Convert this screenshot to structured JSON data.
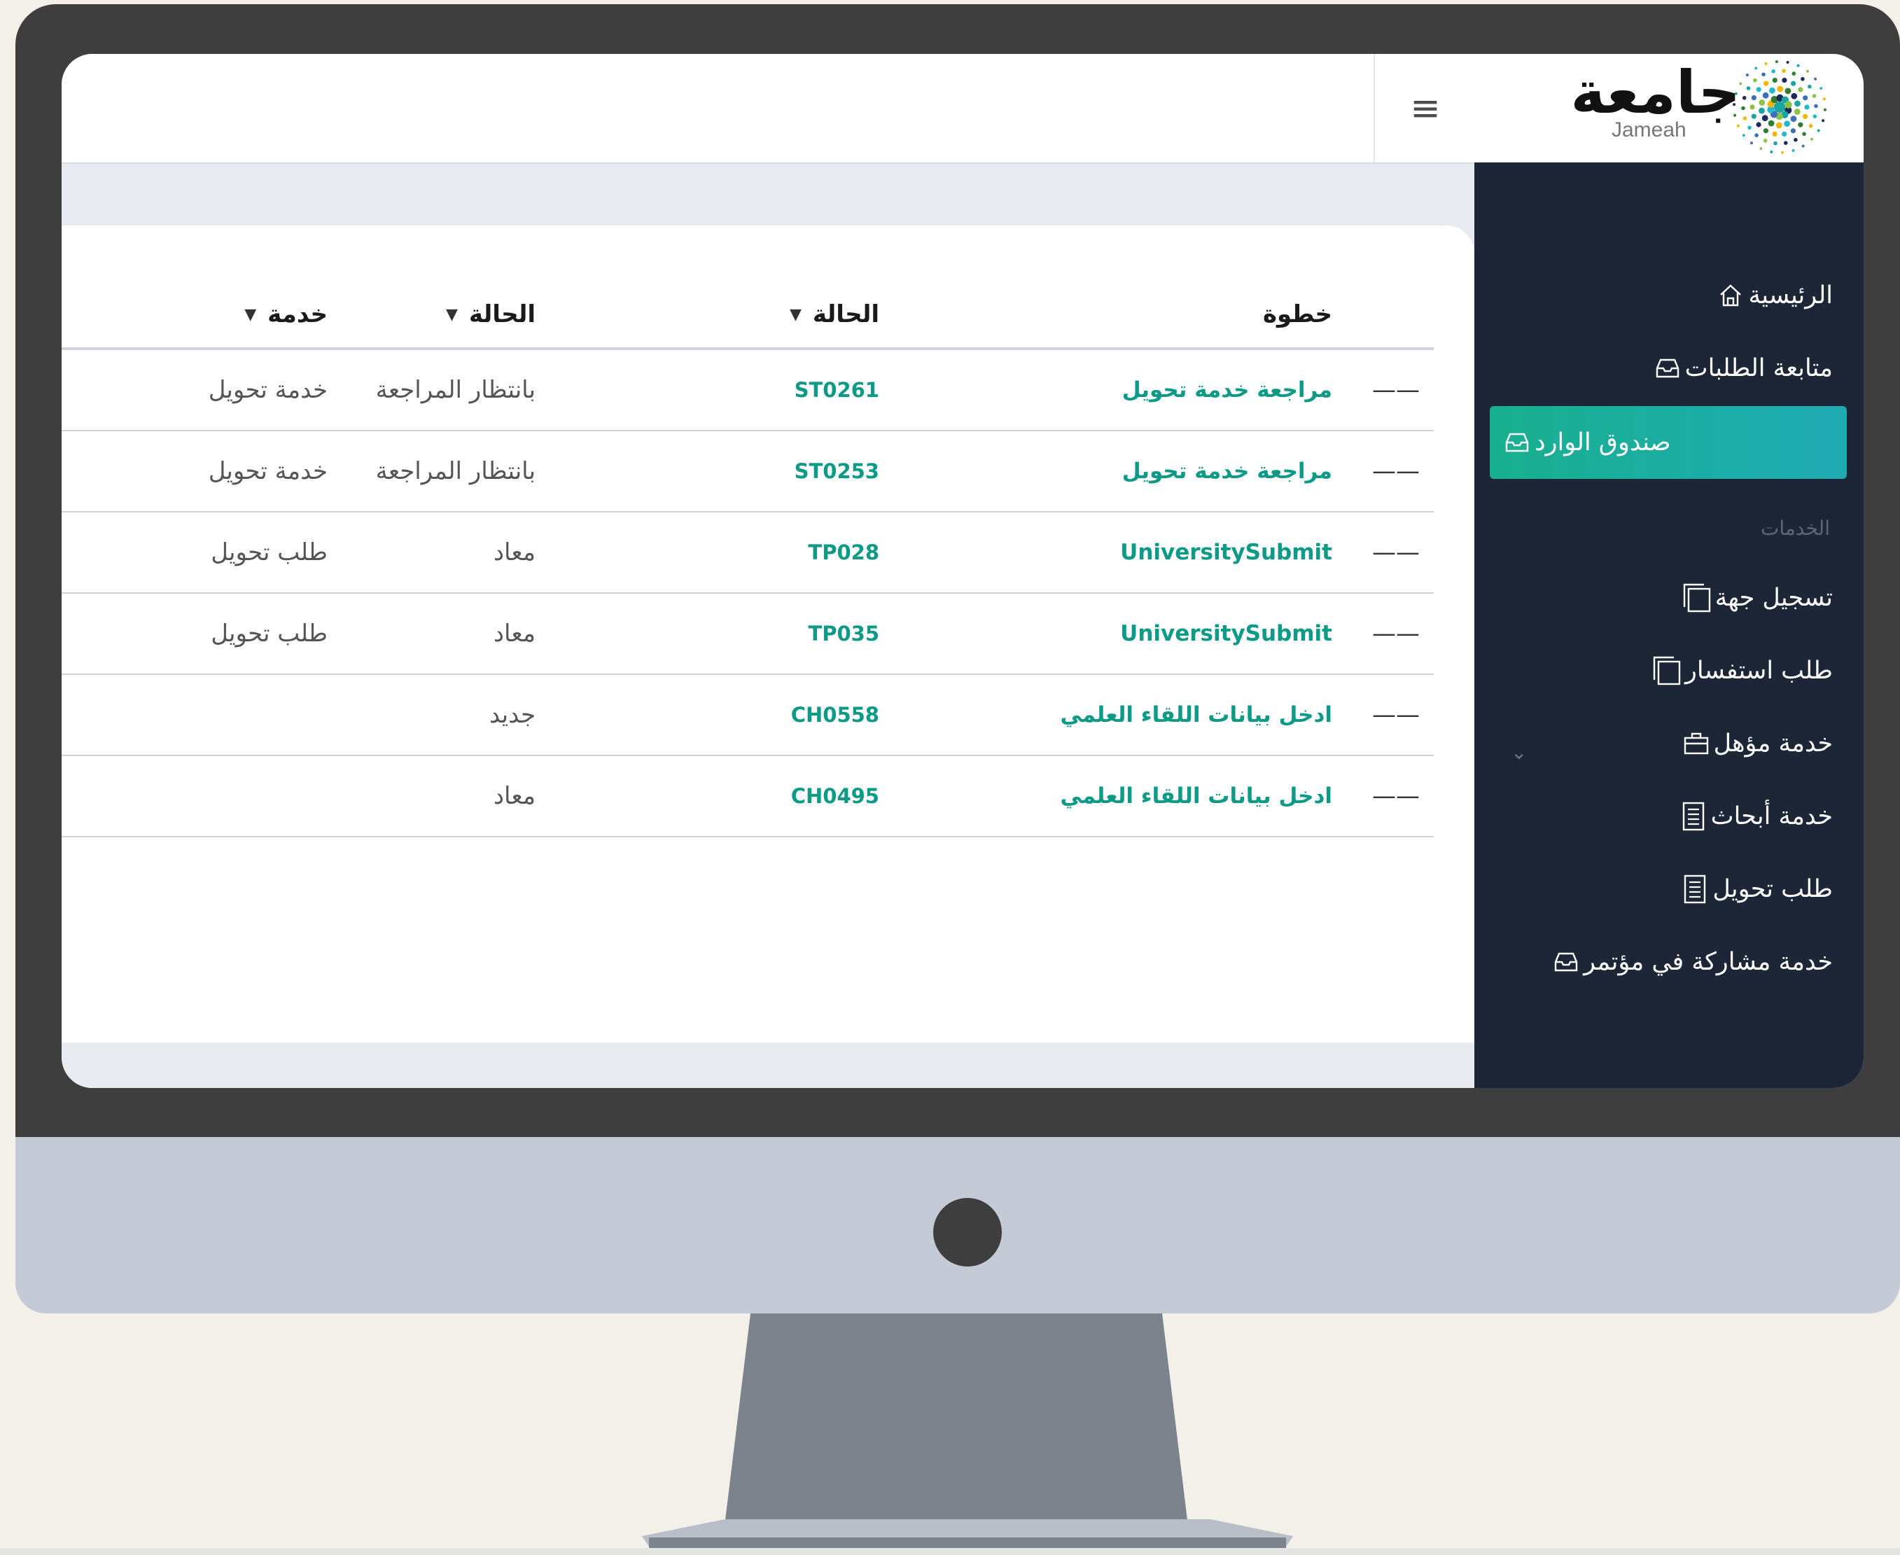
{
  "app": {
    "logo_arabic": "جامعة",
    "logo_latin": "Jameah",
    "menu_toggle_glyph": "≡"
  },
  "sidebar": {
    "items": [
      {
        "label": "الرئيسية",
        "icon": "home-icon"
      },
      {
        "label": "متابعة الطلبات",
        "icon": "inbox-icon"
      },
      {
        "label": "صندوق الوارد",
        "icon": "inbox-icon",
        "active": true
      }
    ],
    "section_label": "الخدمات",
    "service_items": [
      {
        "label": "تسجيل جهة",
        "icon": "copy-icon"
      },
      {
        "label": "طلب استفسار",
        "icon": "copy-icon"
      },
      {
        "label": "خدمة مؤهل",
        "icon": "briefcase-icon",
        "expandable": true
      },
      {
        "label": "خدمة أبحاث",
        "icon": "document-icon"
      },
      {
        "label": "طلب تحويل",
        "icon": "document-icon"
      },
      {
        "label": "خدمة مشاركة في مؤتمر",
        "icon": "inbox-icon"
      }
    ],
    "chevron_glyph": "⌄"
  },
  "table": {
    "headers": {
      "step": "خطوة",
      "code": "الحالة",
      "status": "الحالة",
      "service": "خدمة"
    },
    "filter_glyph": "▼",
    "rows": [
      {
        "dash": "——",
        "step": "مراجعة خدمة تحويل",
        "code": "ST0261",
        "status": "بانتظار المراجعة",
        "service": "خدمة تحويل"
      },
      {
        "dash": "——",
        "step": "مراجعة خدمة تحويل",
        "code": "ST0253",
        "status": "بانتظار المراجعة",
        "service": "خدمة تحويل"
      },
      {
        "dash": "——",
        "step": "UniversitySubmit",
        "code": "TP028",
        "status": "معاد",
        "service": "طلب تحويل"
      },
      {
        "dash": "——",
        "step": "UniversitySubmit",
        "code": "TP035",
        "status": "معاد",
        "service": "طلب تحويل"
      },
      {
        "dash": "——",
        "step": "ادخل بيانات اللقاء العلمي",
        "code": "CH0558",
        "status": "جديد",
        "service": ""
      },
      {
        "dash": "——",
        "step": "ادخل بيانات اللقاء العلمي",
        "code": "CH0495",
        "status": "معاد",
        "service": ""
      }
    ]
  },
  "colors": {
    "accent": "#0d9a86",
    "sidebar_bg": "#1c2637",
    "active_gradient_start": "#19b08f",
    "active_gradient_end": "#1faab3"
  }
}
